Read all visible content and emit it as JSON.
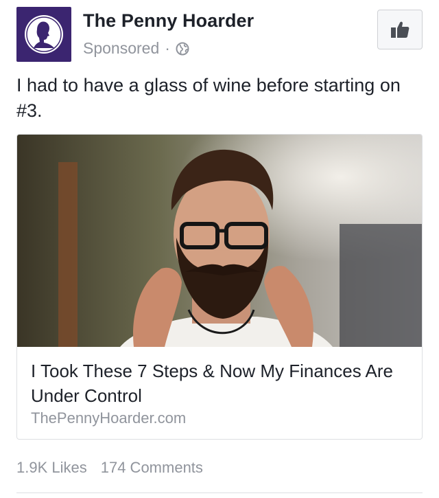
{
  "post": {
    "page_name": "The Penny Hoarder",
    "sponsored_label": "Sponsored",
    "separator": "·",
    "audience_icon": "globe-icon",
    "like_page_icon": "thumbs-up-icon",
    "text": "I had to have a glass of wine before starting on #3.",
    "link": {
      "title": "I Took These 7 Steps & Now My Finances Are Under Control",
      "domain": "ThePennyHoarder.com"
    },
    "stats": {
      "likes": "1.9K Likes",
      "comments": "174 Comments"
    }
  },
  "colors": {
    "avatar_bg": "#3b2570",
    "secondary_text": "#90949c",
    "primary_text": "#1d2129",
    "border": "#dddfe2",
    "button_bg": "#f6f7f9"
  }
}
